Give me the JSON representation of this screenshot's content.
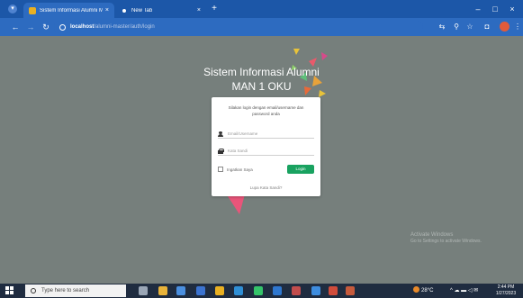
{
  "browser": {
    "tabs": [
      {
        "title": "Sistem Informasi Alumni Man",
        "close": "×"
      },
      {
        "title": "New Tab",
        "close": "×"
      }
    ],
    "new_tab": "+",
    "window_controls": {
      "minimize": "–",
      "maximize": "□",
      "close": "×"
    },
    "nav": {
      "back": "←",
      "forward": "→",
      "reload": "↻"
    },
    "address": {
      "host": "localhost",
      "path": "/alumni-master/auth/login"
    },
    "toolbar_icons": [
      "translate-icon",
      "zoom-icon",
      "bookmark-star-icon",
      "extensions-icon"
    ],
    "toolbar_glyphs": {
      "translate": "⇆",
      "zoom": "⚲",
      "star": "☆",
      "extensions": "◘",
      "more": "⋮"
    }
  },
  "page": {
    "title_line1": "Sistem Informasi Alumni",
    "title_line2": "MAN 1 OKU",
    "login": {
      "message": "Silakan login dengan email/username dan password anda",
      "email_placeholder": "Email/Username",
      "password_placeholder": "Kata Sandi",
      "remember_label": "Ingatkan Saya",
      "login_button": "Login",
      "forgot_link": "Lupa Kata Sandi?"
    },
    "watermark": {
      "line1": "Activate Windows",
      "line2": "Go to Settings to activate Windows."
    }
  },
  "taskbar": {
    "search_placeholder": "Type here to search",
    "apps": [
      "task-view-icon",
      "file-explorer-icon",
      "chrome-icon",
      "store-icon",
      "chrome-icon",
      "edge-icon",
      "whatsapp-icon",
      "vscode-icon",
      "app-icon",
      "app-icon",
      "app-icon",
      "app-icon"
    ],
    "app_colors": [
      "#9aa6b6",
      "#e8b33a",
      "#4a8fe0",
      "#3b73d0",
      "#e9b022",
      "#2f8fd6",
      "#34c46a",
      "#2e77cf",
      "#c24d4d",
      "#3e8ddf",
      "#d04c3b",
      "#c65a3c"
    ],
    "weather": "28°C",
    "tray": "^ ☁ ▬ ◁ ✉",
    "time": "2:44 PM",
    "date": "1/27/2023"
  },
  "colors": {
    "accent": "#2d6bc0",
    "login_button": "#19a260",
    "page_bg": "#767f7c"
  }
}
